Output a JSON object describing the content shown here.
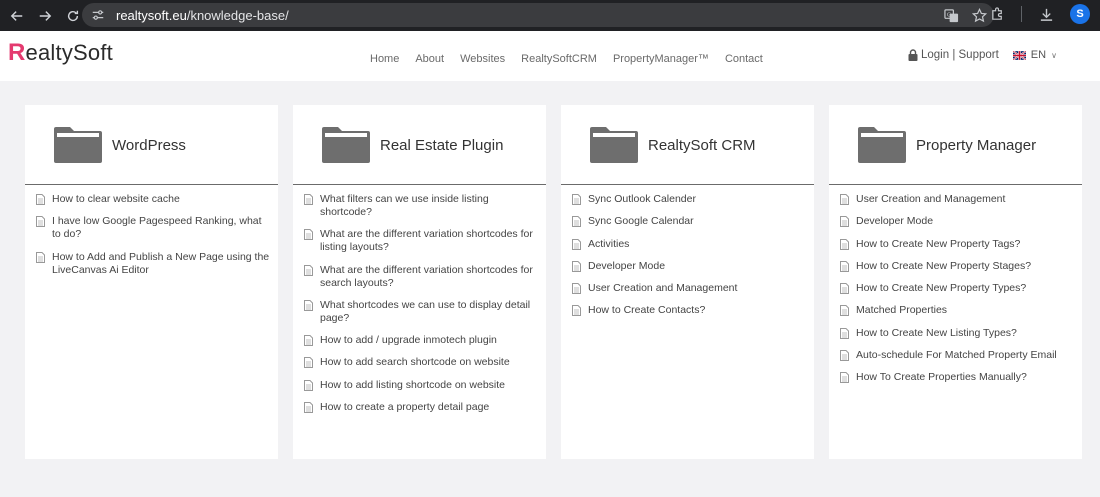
{
  "browser": {
    "url_host": "realtysoft.eu",
    "url_path": "/knowledge-base/",
    "profile_initial": "S"
  },
  "header": {
    "logo_text": "ealtySoft",
    "logo_letter": "R",
    "nav": [
      "Home",
      "About",
      "Websites",
      "RealtySoftCRM",
      "PropertyManager™",
      "Contact"
    ],
    "login": "Login | Support",
    "language": "EN"
  },
  "cards": [
    {
      "title": "WordPress",
      "items": [
        "How to clear website cache",
        "I have low Google Pagespeed Ranking, what to do?",
        "How to Add and Publish a New Page using the LiveCanvas Ai Editor"
      ]
    },
    {
      "title": "Real Estate Plugin",
      "items": [
        "What filters can we use inside listing shortcode?",
        "What are the different variation shortcodes for listing layouts?",
        "What are the different variation shortcodes for search layouts?",
        "What shortcodes we can use to display detail page?",
        "How to add / upgrade inmotech plugin",
        "How to add search shortcode on website",
        "How to add listing shortcode on website",
        "How to create a property detail page"
      ]
    },
    {
      "title": "RealtySoft CRM",
      "items": [
        "Sync Outlook Calender",
        "Sync Google Calendar",
        "Activities",
        "Developer Mode",
        "User Creation and Management",
        "How to Create Contacts?"
      ]
    },
    {
      "title": "Property Manager",
      "items": [
        "User Creation and Management",
        "Developer Mode",
        "How to Create New Property Tags?",
        "How to Create New Property Stages?",
        "How to Create New Property Types?",
        "Matched Properties",
        "How to Create New Listing Types?",
        "Auto-schedule For Matched Property Email",
        "How To Create Properties Manually?"
      ]
    }
  ],
  "colors": {
    "logo_accent": "#e43a6f",
    "folder": "#6e6e6e",
    "page_bg": "#f2f2f4"
  }
}
